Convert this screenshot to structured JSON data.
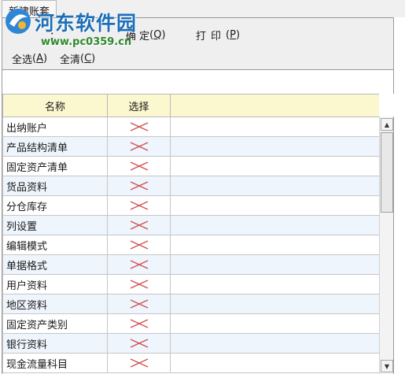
{
  "tab": {
    "label": "新建账套"
  },
  "toolbar": {
    "partial_left": "：",
    "confirm": {
      "label": "确 定",
      "key": "Q"
    },
    "print": {
      "label": "打印",
      "key": "P"
    },
    "select_all": {
      "label": "全选",
      "key": "A"
    },
    "clear_all": {
      "label": "全清",
      "key": "C"
    }
  },
  "watermark": {
    "title": "河东软件园",
    "url": "www.pc0359.cn",
    "color": "#1d6fb8"
  },
  "grid": {
    "headers": [
      "名称",
      "选择",
      ""
    ],
    "header_bg": "#fbf7cf",
    "alt_row_bg": "#eef5fc",
    "cross_color": "#d05050",
    "rows": [
      {
        "name": "出纳账户",
        "selected": false
      },
      {
        "name": "产品结构清单",
        "selected": false
      },
      {
        "name": "固定资产清单",
        "selected": false
      },
      {
        "name": "货品资料",
        "selected": false
      },
      {
        "name": "分仓库存",
        "selected": false
      },
      {
        "name": "列设置",
        "selected": false
      },
      {
        "name": "编辑模式",
        "selected": false
      },
      {
        "name": "单据格式",
        "selected": false
      },
      {
        "name": "用户资料",
        "selected": false
      },
      {
        "name": "地区资料",
        "selected": false
      },
      {
        "name": "固定资产类别",
        "selected": false
      },
      {
        "name": "银行资料",
        "selected": false
      },
      {
        "name": "现金流量科目",
        "selected": false
      }
    ]
  }
}
